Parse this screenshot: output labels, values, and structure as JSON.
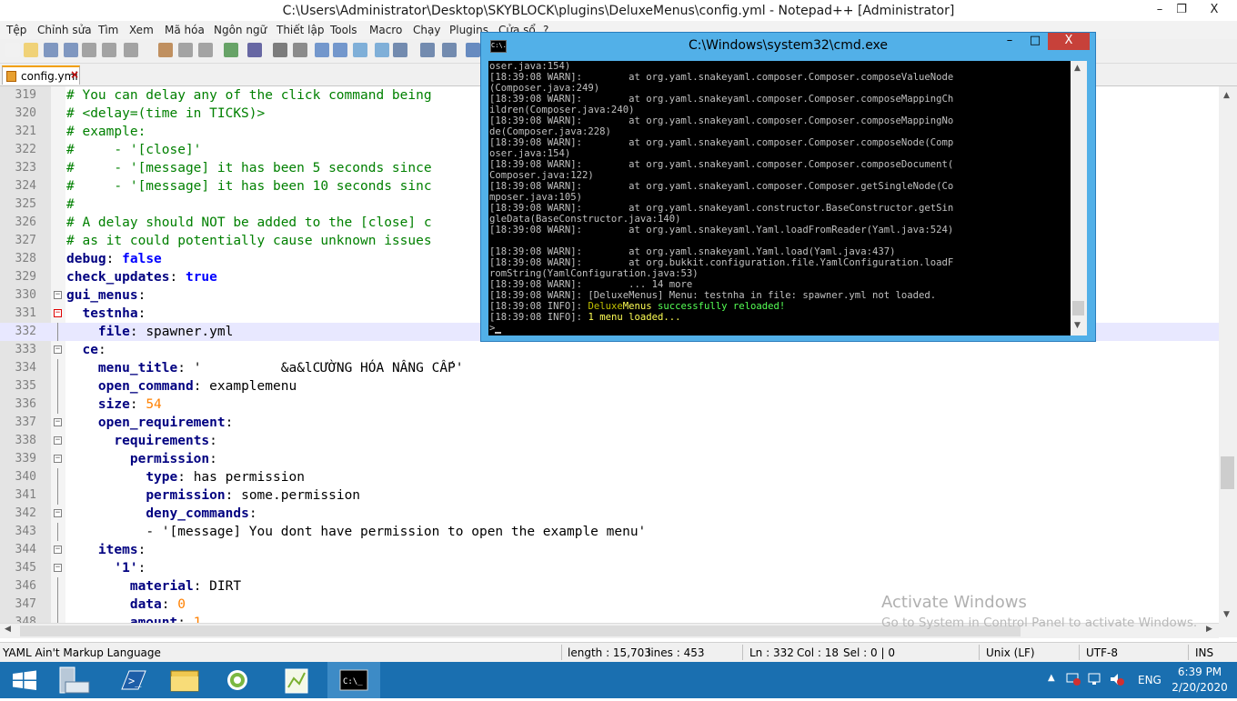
{
  "npp": {
    "title": "C:\\Users\\Administrator\\Desktop\\SKYBLOCK\\plugins\\DeluxeMenus\\config.yml - Notepad++ [Administrator]",
    "menu": [
      "Tệp",
      "Chỉnh sửa",
      "Tìm",
      "Xem",
      "Mã hóa",
      "Ngôn ngữ",
      "Thiết lập",
      "Tools",
      "Macro",
      "Chạy",
      "Plugins",
      "Cửa sổ",
      "?"
    ],
    "close_x": "X",
    "tab": "config.yml"
  },
  "editor": {
    "lines": [
      {
        "n": "319",
        "c": "# You can delay any of the click command being"
      },
      {
        "n": "320",
        "c": "# <delay=(time in TICKS)>"
      },
      {
        "n": "321",
        "c": "# example:"
      },
      {
        "n": "322",
        "c": "#     - '[close]'"
      },
      {
        "n": "323",
        "c": "#     - '[message] it has been 5 seconds since"
      },
      {
        "n": "324",
        "c": "#     - '[message] it has been 10 seconds sinc"
      },
      {
        "n": "325",
        "c": "#"
      },
      {
        "n": "326",
        "c": "# A delay should NOT be added to the [close] c"
      },
      {
        "n": "327",
        "c": "# as it could potentially cause unknown issues"
      },
      {
        "n": "328",
        "k": "debug",
        "s": ": ",
        "v": "false",
        "vt": "bo"
      },
      {
        "n": "329",
        "k": "check_updates",
        "s": ": ",
        "v": "true",
        "vt": "bo"
      },
      {
        "n": "330",
        "k": "gui_menus",
        "s": ":",
        "v": ""
      },
      {
        "n": "331",
        "i": "  ",
        "k": "testnha",
        "s": ":",
        "v": ""
      },
      {
        "n": "332",
        "i": "    ",
        "k": "file",
        "s": ": ",
        "v": "spawner.yml"
      },
      {
        "n": "333",
        "i": "  ",
        "k": "ce",
        "s": ":",
        "v": ""
      },
      {
        "n": "334",
        "i": "    ",
        "k": "menu_title",
        "s": ": ",
        "v": "'          &a&lCƯỜNG HÓA NÂNG CẤP'"
      },
      {
        "n": "335",
        "i": "    ",
        "k": "open_command",
        "s": ": ",
        "v": "examplemenu"
      },
      {
        "n": "336",
        "i": "    ",
        "k": "size",
        "s": ": ",
        "v": "54",
        "vt": "nu"
      },
      {
        "n": "337",
        "i": "    ",
        "k": "open_requirement",
        "s": ":",
        "v": ""
      },
      {
        "n": "338",
        "i": "      ",
        "k": "requirements",
        "s": ":",
        "v": ""
      },
      {
        "n": "339",
        "i": "        ",
        "k": "permission",
        "s": ":",
        "v": ""
      },
      {
        "n": "340",
        "i": "          ",
        "k": "type",
        "s": ": ",
        "v": "has permission"
      },
      {
        "n": "341",
        "i": "          ",
        "k": "permission",
        "s": ": ",
        "v": "some.permission"
      },
      {
        "n": "342",
        "i": "          ",
        "k": "deny_commands",
        "s": ":",
        "v": ""
      },
      {
        "n": "343",
        "i": "          ",
        "k": "",
        "s": "",
        "v": "- '[message] You dont have permission to open the example menu'"
      },
      {
        "n": "344",
        "i": "    ",
        "k": "items",
        "s": ":",
        "v": ""
      },
      {
        "n": "345",
        "i": "      ",
        "k": "'1'",
        "s": ":",
        "v": ""
      },
      {
        "n": "346",
        "i": "        ",
        "k": "material",
        "s": ": ",
        "v": "DIRT"
      },
      {
        "n": "347",
        "i": "        ",
        "k": "data",
        "s": ": ",
        "v": "0",
        "vt": "nu"
      },
      {
        "n": "348",
        "i": "        ",
        "k": "amount",
        "s": ": ",
        "v": "1",
        "vt": "nu"
      }
    ]
  },
  "status": {
    "language": "YAML Ain't Markup Language",
    "length": "length : 15,703",
    "lines": "lines : 453",
    "ln": "Ln : 332",
    "col": "Col : 18",
    "sel": "Sel : 0 | 0",
    "eol": "Unix (LF)",
    "encoding": "UTF-8",
    "mode": "INS"
  },
  "watermark": {
    "line1": "Activate Windows",
    "line2": "Go to System in Control Panel to activate Windows."
  },
  "cmd": {
    "title": "C:\\Windows\\system32\\cmd.exe",
    "icon_text": "C:\\.",
    "close_x": "X",
    "lines": [
      "oser.java:154)",
      "[18:39:08 WARN]:        at org.yaml.snakeyaml.composer.Composer.composeValueNode",
      "(Composer.java:249)",
      "[18:39:08 WARN]:        at org.yaml.snakeyaml.composer.Composer.composeMappingCh",
      "ildren(Composer.java:240)",
      "[18:39:08 WARN]:        at org.yaml.snakeyaml.composer.Composer.composeMappingNo",
      "de(Composer.java:228)",
      "[18:39:08 WARN]:        at org.yaml.snakeyaml.composer.Composer.composeNode(Comp",
      "oser.java:154)",
      "[18:39:08 WARN]:        at org.yaml.snakeyaml.composer.Composer.composeDocument(",
      "Composer.java:122)",
      "[18:39:08 WARN]:        at org.yaml.snakeyaml.composer.Composer.getSingleNode(Co",
      "mposer.java:105)",
      "[18:39:08 WARN]:        at org.yaml.snakeyaml.constructor.BaseConstructor.getSin",
      "gleData(BaseConstructor.java:140)",
      "[18:39:08 WARN]:        at org.yaml.snakeyaml.Yaml.loadFromReader(Yaml.java:524)",
      "",
      "[18:39:08 WARN]:        at org.yaml.snakeyaml.Yaml.load(Yaml.java:437)",
      "[18:39:08 WARN]:        at org.bukkit.configuration.file.YamlConfiguration.loadF",
      "romString(YamlConfiguration.java:53)",
      "[18:39:08 WARN]:        ... 14 more",
      "[18:39:08 WARN]: [DeluxeMenus] Menu: testnha in file: spawner.yml not loaded."
    ],
    "reload_prefix": "[18:39:08 INFO]: ",
    "reload_deluxe": "Deluxe",
    "reload_menus": "Menus",
    "reload_msg": " successfully reloaded!",
    "loaded_prefix": "[18:39:08 INFO]: ",
    "loaded_msg": "1 menu loaded...",
    "prompt": ">"
  },
  "taskbar": {
    "lang": "ENG",
    "time": "6:39 PM",
    "date": "2/20/2020"
  }
}
